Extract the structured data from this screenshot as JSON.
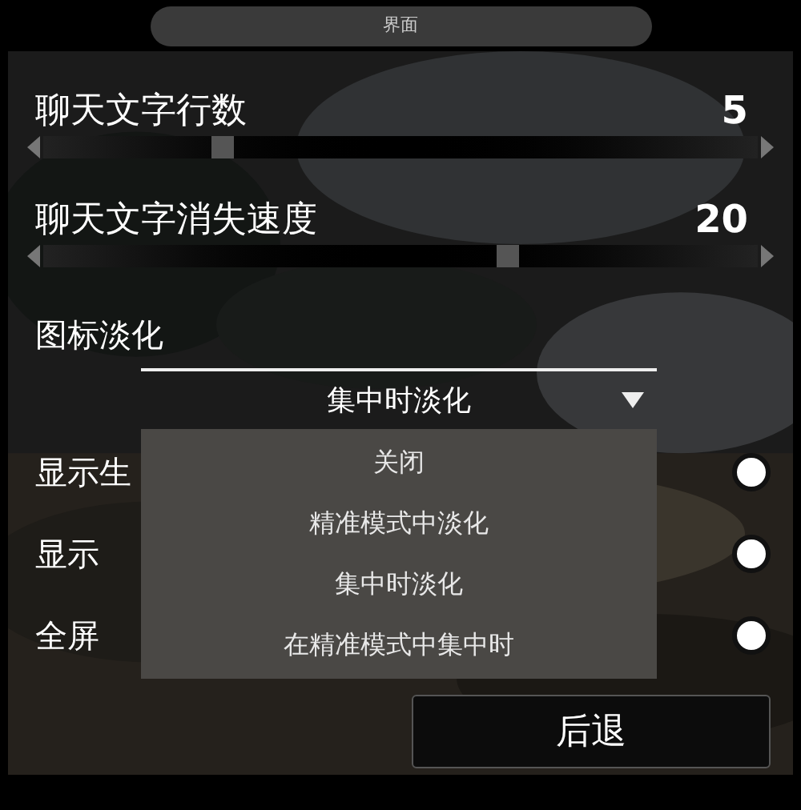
{
  "title": "界面",
  "sliders": [
    {
      "label": "聊天文字行数",
      "reading": "5",
      "level": 0.25
    },
    {
      "label": "聊天文字消失速度",
      "reading": "20",
      "level": 0.65
    }
  ],
  "dropdown": {
    "label": "图标淡化",
    "value": "集中时淡化",
    "expanded": true,
    "options": [
      "关闭",
      "精准模式中淡化",
      "集中时淡化",
      "在精准模式中集中时"
    ]
  },
  "toggles": [
    {
      "label": "显示生",
      "on": true
    },
    {
      "label": "显示",
      "on": true
    },
    {
      "label": "全屏",
      "on": true
    }
  ],
  "back_button": "后退"
}
